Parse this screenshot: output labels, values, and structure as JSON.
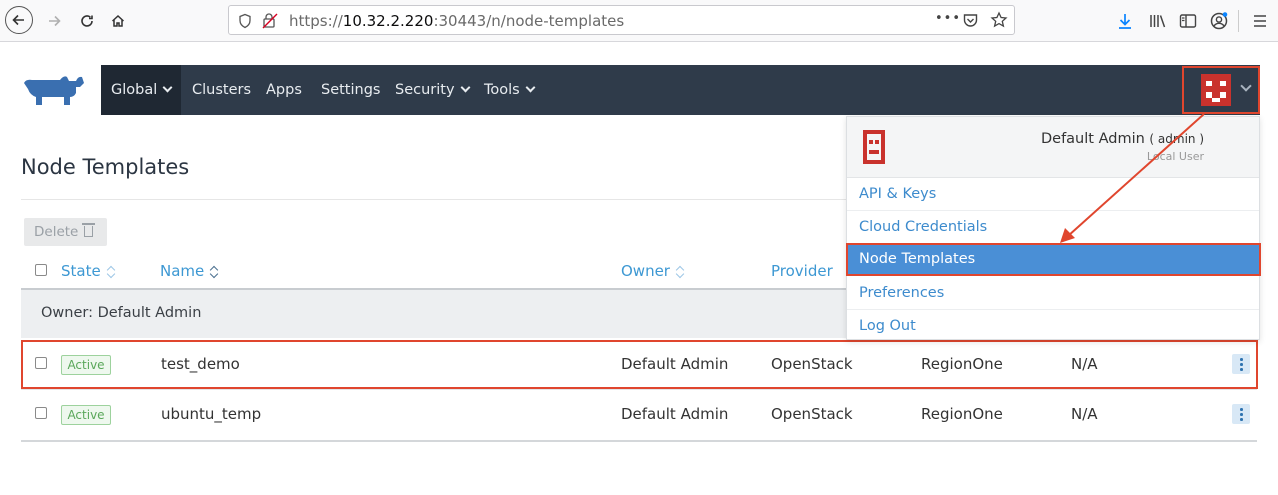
{
  "browser": {
    "url_prefix": "https://",
    "url_host": "10.32.2.220",
    "url_path": ":30443/n/node-templates",
    "more_label": "•••"
  },
  "nav": {
    "items": [
      {
        "label": "Global"
      },
      {
        "label": "Clusters"
      },
      {
        "label": "Apps"
      },
      {
        "label": "Settings"
      },
      {
        "label": "Security"
      },
      {
        "label": "Tools"
      }
    ]
  },
  "page": {
    "title": "Node Templates",
    "delete_label": "Delete"
  },
  "table": {
    "columns": [
      "State",
      "Name",
      "Owner",
      "Provider"
    ],
    "group_label": "Owner: Default Admin",
    "rows": [
      {
        "state": "Active",
        "name": "test_demo",
        "owner": "Default Admin",
        "provider": "OpenStack",
        "region": "RegionOne",
        "extra": "N/A"
      },
      {
        "state": "Active",
        "name": "ubuntu_temp",
        "owner": "Default Admin",
        "provider": "OpenStack",
        "region": "RegionOne",
        "extra": "N/A"
      }
    ]
  },
  "user_menu": {
    "display_name": "Default Admin",
    "username": "( admin )",
    "user_type": "Local User",
    "items": [
      {
        "label": "API & Keys"
      },
      {
        "label": "Cloud Credentials"
      },
      {
        "label": "Node Templates",
        "selected": true
      },
      {
        "label": "Preferences"
      },
      {
        "label": "Log Out"
      }
    ]
  },
  "colors": {
    "nav_bg": "#2f3b4a",
    "accent_link": "#3d98d3",
    "highlight": "#e0462e",
    "selected_bg": "#4a8fd6",
    "avatar_red": "#c9322d"
  }
}
